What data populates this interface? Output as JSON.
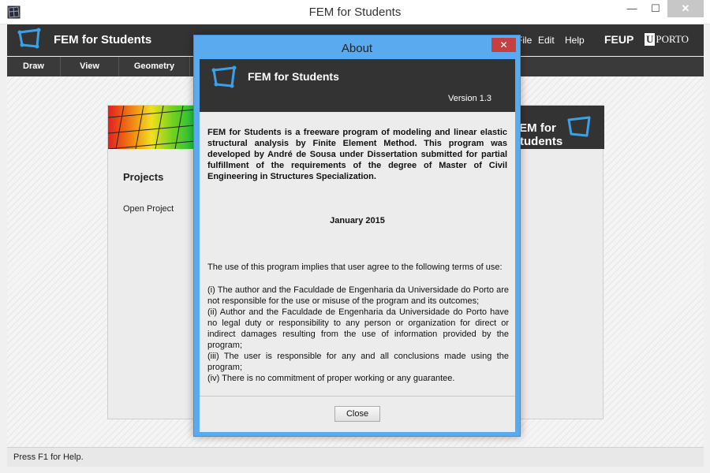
{
  "window": {
    "title": "FEM for Students",
    "minimize_glyph": "—",
    "maximize_glyph": "☐",
    "close_glyph": "✕"
  },
  "header": {
    "app_name": "FEM for Students",
    "menu": [
      "File",
      "Edit",
      "Help"
    ],
    "feup": "FEUP",
    "uporto_u": "U",
    "uporto_text": "PORTO"
  },
  "toolbar": {
    "tabs": [
      "Draw",
      "View",
      "Geometry"
    ]
  },
  "panel": {
    "banner_title": "FEM for Students",
    "projects_heading": "Projects",
    "open_project": "Open Project"
  },
  "status": {
    "text": "Press F1 for Help."
  },
  "about": {
    "title": "About",
    "close_glyph": "✕",
    "app_name": "FEM for Students",
    "version": "Version 1.3",
    "description": "FEM for Students is a freeware program of modeling and linear elastic structural analysis by Finite Element Method. This program was developed by André de Sousa under Dissertation submitted for partial fulfillment of the requirements of the degree of Master of Civil Engineering in Structures Specialization.",
    "date": "January 2015",
    "terms_intro": "The use of this program implies that user agree to the following terms of use:",
    "terms": [
      "(i) The author and the Faculdade de Engenharia da Universidade do Porto are not responsible for the use or misuse of the program and its outcomes;",
      "(ii) Author and the Faculdade de Engenharia da Universidade do Porto have no legal duty or responsibility to any person or organization for direct or indirect damages resulting from the use of information provided by the program;",
      "(iii) The user is responsible for any and all conclusions made using the program;",
      "(iv) There is no commitment of proper working or any guarantee."
    ],
    "close_button": "Close"
  },
  "colors": {
    "header_bg": "#333333",
    "dialog_frame": "#5aaaf0",
    "close_red": "#c74040"
  },
  "icons": [
    "app-window-icon",
    "fem-logo-icon",
    "mesh-thumbnail-icon"
  ]
}
